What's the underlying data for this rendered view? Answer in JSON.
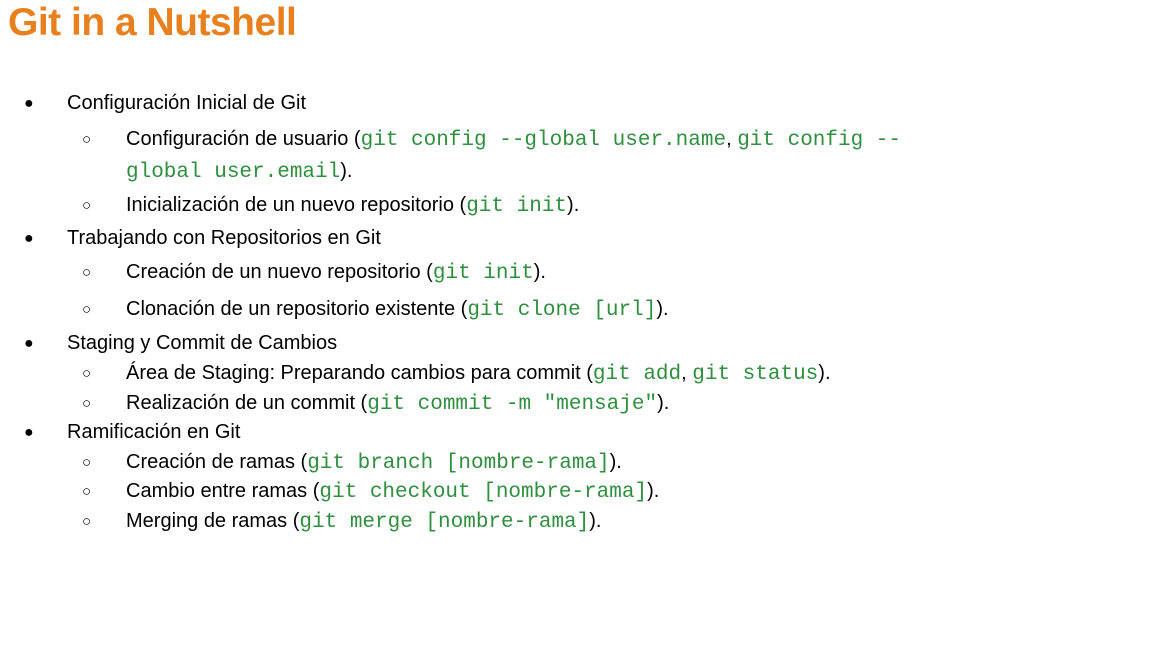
{
  "slide": {
    "title": "Git in a Nutshell",
    "accent_color": "#e8801e",
    "code_color": "#2f8f3f",
    "items": [
      {
        "level": 1,
        "segments": [
          {
            "t": "Configuración Inicial de Git"
          }
        ]
      },
      {
        "level": 2,
        "segments": [
          {
            "t": "Configuración de usuario ("
          },
          {
            "t": "git config --global user.name",
            "code": true
          },
          {
            "t": ", "
          },
          {
            "t": "git config --global user.email",
            "code": true
          },
          {
            "t": ")."
          }
        ]
      },
      {
        "level": 2,
        "segments": [
          {
            "t": "Inicialización de un nuevo repositorio ("
          },
          {
            "t": "git init",
            "code": true
          },
          {
            "t": ")."
          }
        ]
      },
      {
        "level": 1,
        "segments": [
          {
            "t": "Trabajando con Repositorios en Git"
          }
        ]
      },
      {
        "level": 2,
        "segments": [
          {
            "t": "Creación de un nuevo repositorio ("
          },
          {
            "t": "git init",
            "code": true
          },
          {
            "t": ")."
          }
        ]
      },
      {
        "level": 2,
        "segments": [
          {
            "t": "Clonación de un repositorio existente ("
          },
          {
            "t": "git clone [url]",
            "code": true
          },
          {
            "t": ")."
          }
        ]
      },
      {
        "level": 1,
        "segments": [
          {
            "t": "Staging y Commit de Cambios"
          }
        ]
      },
      {
        "level": 2,
        "segments": [
          {
            "t": "Área de Staging: Preparando cambios para commit ("
          },
          {
            "t": "git add",
            "code": true
          },
          {
            "t": ", "
          },
          {
            "t": "git status",
            "code": true
          },
          {
            "t": ")."
          }
        ]
      },
      {
        "level": 2,
        "segments": [
          {
            "t": "Realización de un commit ("
          },
          {
            "t": "git commit -m \"mensaje\"",
            "code": true
          },
          {
            "t": ")."
          }
        ]
      },
      {
        "level": 1,
        "segments": [
          {
            "t": "Ramificación en Git"
          }
        ]
      },
      {
        "level": 2,
        "segments": [
          {
            "t": "Creación de ramas ("
          },
          {
            "t": "git branch [nombre-rama]",
            "code": true
          },
          {
            "t": ")."
          }
        ]
      },
      {
        "level": 2,
        "segments": [
          {
            "t": "Cambio entre ramas ("
          },
          {
            "t": "git checkout [nombre-rama]",
            "code": true
          },
          {
            "t": ")."
          }
        ]
      },
      {
        "level": 2,
        "segments": [
          {
            "t": "Merging de ramas ("
          },
          {
            "t": "git merge [nombre-rama]",
            "code": true
          },
          {
            "t": ")."
          }
        ]
      }
    ]
  }
}
